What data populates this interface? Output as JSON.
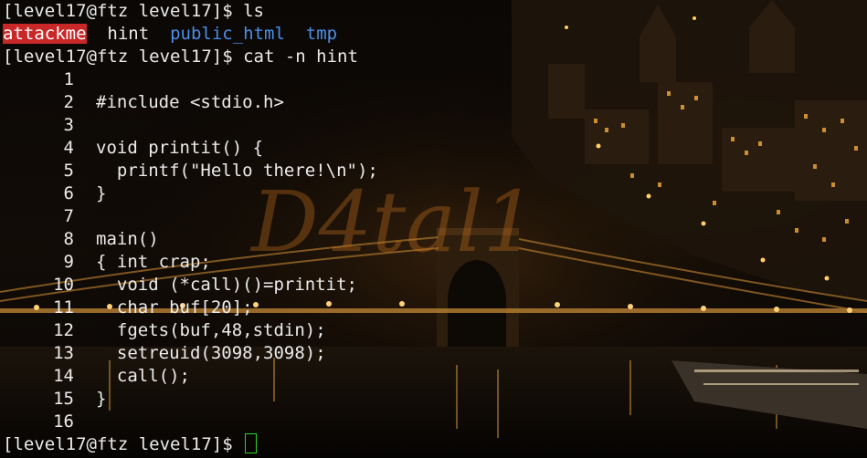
{
  "wallpaper": {
    "watermark": "D4tal1",
    "colors": {
      "sky": "#0b0806",
      "lights": "#f2b23a",
      "water": "#1a120a",
      "watermark": "#c9731f"
    }
  },
  "terminal": {
    "colors": {
      "text": "#ececec",
      "executable_bg": "#c82828",
      "directory": "#4b8fe8",
      "cursor": "#2ad12a"
    },
    "line1": {
      "prompt": "[level17@ftz level17]$ ",
      "command": "ls"
    },
    "ls_output": {
      "executable": "attackme",
      "file": "hint",
      "dir1": "public_html",
      "dir2": "tmp"
    },
    "line3": {
      "prompt": "[level17@ftz level17]$ ",
      "command": "cat -n hint"
    },
    "code_lines": [
      {
        "n": "1",
        "text": ""
      },
      {
        "n": "2",
        "text": "#include <stdio.h>"
      },
      {
        "n": "3",
        "text": ""
      },
      {
        "n": "4",
        "text": "void printit() {"
      },
      {
        "n": "5",
        "text": "  printf(\"Hello there!\\n\");"
      },
      {
        "n": "6",
        "text": "}"
      },
      {
        "n": "7",
        "text": ""
      },
      {
        "n": "8",
        "text": "main()"
      },
      {
        "n": "9",
        "text": "{ int crap;"
      },
      {
        "n": "10",
        "text": "  void (*call)()=printit;"
      },
      {
        "n": "11",
        "text": "  char buf[20];"
      },
      {
        "n": "12",
        "text": "  fgets(buf,48,stdin);"
      },
      {
        "n": "13",
        "text": "  setreuid(3098,3098);"
      },
      {
        "n": "14",
        "text": "  call();"
      },
      {
        "n": "15",
        "text": "}"
      },
      {
        "n": "16",
        "text": ""
      }
    ],
    "last_prompt": "[level17@ftz level17]$ "
  }
}
